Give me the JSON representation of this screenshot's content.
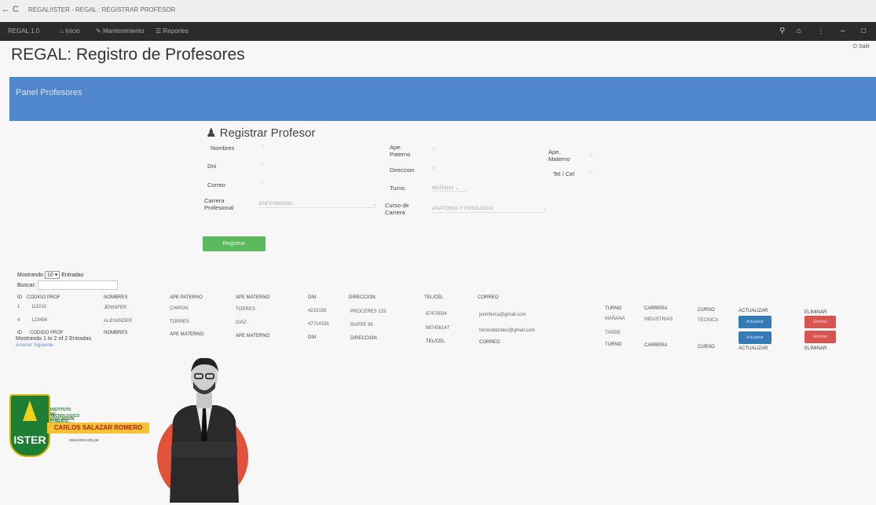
{
  "browser": {
    "tab_title": "REGAL/ISTER - REGAL : REGISTRAR PROFESOR",
    "nav_glyphs": "← C"
  },
  "topbar": {
    "brand": "REGAL 1.0",
    "nav_items": [
      "Inicio",
      "Mantenimiento",
      "Reportes"
    ],
    "logout": "Salir"
  },
  "page_title": "REGAL: Registro de Profesores",
  "panel": {
    "title": "Panel Profesores"
  },
  "form": {
    "title": "Registrar Profesor",
    "labels": {
      "nombres": "Nombres",
      "ape_paterno": "Ape. Paterno",
      "ape_materno": "Ape. Materno",
      "dni": "Dni",
      "direccion": "Direccion",
      "tel_cel": "Tel / Cel",
      "correo": "Correo",
      "turno": "Turno",
      "carrera": "Carrera Profesional",
      "curso": "Curso de Carrera"
    },
    "turno_value": "MAÑANA",
    "carrera_value": "ENFERMERIA",
    "curso_value": "ANATOMIA Y FISIOLOGIA",
    "submit": "Registrar"
  },
  "datatable": {
    "length_prefix": "Mostrando",
    "length_value": "10",
    "length_suffix": "Entradas",
    "search_label": "Buscar:",
    "columns": [
      "ID",
      "CODIGO PROF",
      "NOMBRES",
      "APE PATERNO",
      "APE MATERNO",
      "DNI",
      "DIRECCION",
      "TEL/CEL",
      "CORREO",
      "TURNO",
      "CARRERA",
      "CURSO",
      "ACTUALIZAR",
      "ELIMINAR"
    ],
    "rows": [
      [
        "1",
        "111010",
        "JENNIFER",
        "CHIRON",
        "TORRES",
        "4232158",
        "PROCERES 123",
        "87478534",
        "jenniferca@gmail.com",
        "MAÑANA",
        "INDUSTRIAS",
        "TECNICA"
      ],
      [
        "4",
        "123456",
        "ALEXANDER",
        "TORRES",
        "DIAZ",
        "47714326",
        "RAPPE 96",
        "987456147",
        "torresdiazalex@gmail.com",
        "TARDE",
        "",
        ""
      ]
    ],
    "footer": [
      "ID",
      "CODIGO PROF",
      "NOMBRES",
      "APE MATERNO",
      "APE MATERNO",
      "DNI",
      "DIRECCION",
      "TEL/CEL",
      "CORREO",
      "TURNO",
      "CARRERA",
      "CURSO",
      "ACTUALIZAR",
      "ELIMINAR"
    ],
    "update_label": "Actualizar",
    "delete_label": "Eliminar",
    "info": "Mostrando 1 to 2 of 2 Entradas",
    "pagination": "Anterior Siguiente"
  },
  "institution": {
    "name_line1": "INSTITUTO DE EDUCACION SUPERIOR",
    "name_line2": "TECNOLOGICO PUBLICO",
    "name_line3": "CARLOS SALAZAR ROMERO",
    "acronym": "ISTER",
    "note": "www.ister.edu.pe"
  },
  "colors": {
    "panel_blue": "#4f86cc",
    "topbar": "#2b2b2b",
    "success": "#5cb85c",
    "primary": "#337ab7",
    "danger": "#d9534f"
  }
}
